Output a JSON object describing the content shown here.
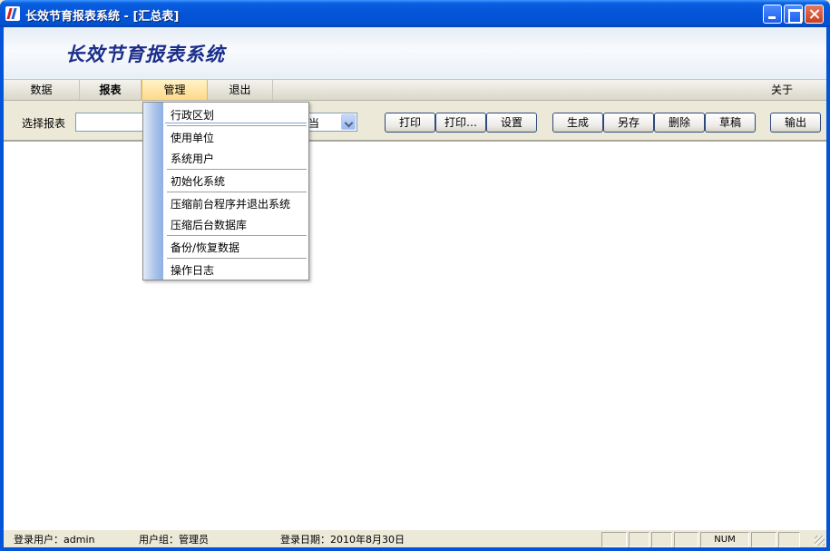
{
  "window": {
    "title": "长效节育报表系统 - [汇总表]"
  },
  "banner": {
    "title": "长效节育报表系统"
  },
  "menubar": {
    "items": [
      {
        "label": "数据"
      },
      {
        "label": "报表"
      },
      {
        "label": "管理"
      },
      {
        "label": "退出"
      }
    ],
    "about": "关于"
  },
  "toolbar": {
    "select_report_label": "选择报表",
    "report_value": "",
    "date_select_value": "当",
    "buttons": {
      "print": "打印",
      "print_more": "打印…",
      "settings": "设置",
      "generate": "生成",
      "save_as": "另存",
      "delete": "删除",
      "draft": "草稿",
      "export": "输出"
    }
  },
  "dropdown": {
    "items": [
      "行政区划",
      "使用单位",
      "系统用户",
      "初始化系统",
      "压缩前台程序并退出系统",
      "压缩后台数据库",
      "备份/恢复数据",
      "操作日志"
    ]
  },
  "statusbar": {
    "user": "登录用户：admin",
    "group": "用户组：管理员",
    "date": "登录日期：2010年8月30日",
    "num": "NUM"
  },
  "colors": {
    "titlebar": "#0454d8",
    "banner_text": "#1a2d8a",
    "menu_highlight": "#ffd98a",
    "dropdown_strip": "#a9c2ea"
  }
}
